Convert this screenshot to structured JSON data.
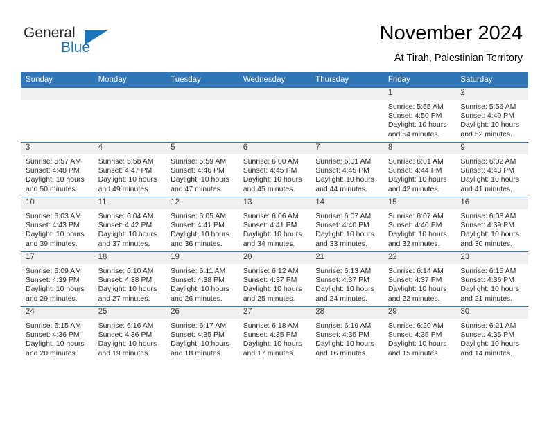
{
  "brand": {
    "name_part1": "General",
    "name_part2": "Blue",
    "triangle_color": "#1b75bb",
    "text_color": "#231f20"
  },
  "header": {
    "month_title": "November 2024",
    "location": "At Tirah, Palestinian Territory"
  },
  "theme": {
    "header_blue": "#3075b5",
    "date_band_gray": "#f0f0f0",
    "cell_white": "#ffffff"
  },
  "calendar": {
    "weekday_headers": [
      "Sunday",
      "Monday",
      "Tuesday",
      "Wednesday",
      "Thursday",
      "Friday",
      "Saturday"
    ],
    "weeks": [
      [
        {
          "day": "",
          "sunrise": "",
          "sunset": "",
          "daylight_line1": "",
          "daylight_line2": ""
        },
        {
          "day": "",
          "sunrise": "",
          "sunset": "",
          "daylight_line1": "",
          "daylight_line2": ""
        },
        {
          "day": "",
          "sunrise": "",
          "sunset": "",
          "daylight_line1": "",
          "daylight_line2": ""
        },
        {
          "day": "",
          "sunrise": "",
          "sunset": "",
          "daylight_line1": "",
          "daylight_line2": ""
        },
        {
          "day": "",
          "sunrise": "",
          "sunset": "",
          "daylight_line1": "",
          "daylight_line2": ""
        },
        {
          "day": "1",
          "sunrise": "Sunrise: 5:55 AM",
          "sunset": "Sunset: 4:50 PM",
          "daylight_line1": "Daylight: 10 hours",
          "daylight_line2": "and 54 minutes."
        },
        {
          "day": "2",
          "sunrise": "Sunrise: 5:56 AM",
          "sunset": "Sunset: 4:49 PM",
          "daylight_line1": "Daylight: 10 hours",
          "daylight_line2": "and 52 minutes."
        }
      ],
      [
        {
          "day": "3",
          "sunrise": "Sunrise: 5:57 AM",
          "sunset": "Sunset: 4:48 PM",
          "daylight_line1": "Daylight: 10 hours",
          "daylight_line2": "and 50 minutes."
        },
        {
          "day": "4",
          "sunrise": "Sunrise: 5:58 AM",
          "sunset": "Sunset: 4:47 PM",
          "daylight_line1": "Daylight: 10 hours",
          "daylight_line2": "and 49 minutes."
        },
        {
          "day": "5",
          "sunrise": "Sunrise: 5:59 AM",
          "sunset": "Sunset: 4:46 PM",
          "daylight_line1": "Daylight: 10 hours",
          "daylight_line2": "and 47 minutes."
        },
        {
          "day": "6",
          "sunrise": "Sunrise: 6:00 AM",
          "sunset": "Sunset: 4:45 PM",
          "daylight_line1": "Daylight: 10 hours",
          "daylight_line2": "and 45 minutes."
        },
        {
          "day": "7",
          "sunrise": "Sunrise: 6:01 AM",
          "sunset": "Sunset: 4:45 PM",
          "daylight_line1": "Daylight: 10 hours",
          "daylight_line2": "and 44 minutes."
        },
        {
          "day": "8",
          "sunrise": "Sunrise: 6:01 AM",
          "sunset": "Sunset: 4:44 PM",
          "daylight_line1": "Daylight: 10 hours",
          "daylight_line2": "and 42 minutes."
        },
        {
          "day": "9",
          "sunrise": "Sunrise: 6:02 AM",
          "sunset": "Sunset: 4:43 PM",
          "daylight_line1": "Daylight: 10 hours",
          "daylight_line2": "and 41 minutes."
        }
      ],
      [
        {
          "day": "10",
          "sunrise": "Sunrise: 6:03 AM",
          "sunset": "Sunset: 4:43 PM",
          "daylight_line1": "Daylight: 10 hours",
          "daylight_line2": "and 39 minutes."
        },
        {
          "day": "11",
          "sunrise": "Sunrise: 6:04 AM",
          "sunset": "Sunset: 4:42 PM",
          "daylight_line1": "Daylight: 10 hours",
          "daylight_line2": "and 37 minutes."
        },
        {
          "day": "12",
          "sunrise": "Sunrise: 6:05 AM",
          "sunset": "Sunset: 4:41 PM",
          "daylight_line1": "Daylight: 10 hours",
          "daylight_line2": "and 36 minutes."
        },
        {
          "day": "13",
          "sunrise": "Sunrise: 6:06 AM",
          "sunset": "Sunset: 4:41 PM",
          "daylight_line1": "Daylight: 10 hours",
          "daylight_line2": "and 34 minutes."
        },
        {
          "day": "14",
          "sunrise": "Sunrise: 6:07 AM",
          "sunset": "Sunset: 4:40 PM",
          "daylight_line1": "Daylight: 10 hours",
          "daylight_line2": "and 33 minutes."
        },
        {
          "day": "15",
          "sunrise": "Sunrise: 6:07 AM",
          "sunset": "Sunset: 4:40 PM",
          "daylight_line1": "Daylight: 10 hours",
          "daylight_line2": "and 32 minutes."
        },
        {
          "day": "16",
          "sunrise": "Sunrise: 6:08 AM",
          "sunset": "Sunset: 4:39 PM",
          "daylight_line1": "Daylight: 10 hours",
          "daylight_line2": "and 30 minutes."
        }
      ],
      [
        {
          "day": "17",
          "sunrise": "Sunrise: 6:09 AM",
          "sunset": "Sunset: 4:39 PM",
          "daylight_line1": "Daylight: 10 hours",
          "daylight_line2": "and 29 minutes."
        },
        {
          "day": "18",
          "sunrise": "Sunrise: 6:10 AM",
          "sunset": "Sunset: 4:38 PM",
          "daylight_line1": "Daylight: 10 hours",
          "daylight_line2": "and 27 minutes."
        },
        {
          "day": "19",
          "sunrise": "Sunrise: 6:11 AM",
          "sunset": "Sunset: 4:38 PM",
          "daylight_line1": "Daylight: 10 hours",
          "daylight_line2": "and 26 minutes."
        },
        {
          "day": "20",
          "sunrise": "Sunrise: 6:12 AM",
          "sunset": "Sunset: 4:37 PM",
          "daylight_line1": "Daylight: 10 hours",
          "daylight_line2": "and 25 minutes."
        },
        {
          "day": "21",
          "sunrise": "Sunrise: 6:13 AM",
          "sunset": "Sunset: 4:37 PM",
          "daylight_line1": "Daylight: 10 hours",
          "daylight_line2": "and 24 minutes."
        },
        {
          "day": "22",
          "sunrise": "Sunrise: 6:14 AM",
          "sunset": "Sunset: 4:37 PM",
          "daylight_line1": "Daylight: 10 hours",
          "daylight_line2": "and 22 minutes."
        },
        {
          "day": "23",
          "sunrise": "Sunrise: 6:15 AM",
          "sunset": "Sunset: 4:36 PM",
          "daylight_line1": "Daylight: 10 hours",
          "daylight_line2": "and 21 minutes."
        }
      ],
      [
        {
          "day": "24",
          "sunrise": "Sunrise: 6:15 AM",
          "sunset": "Sunset: 4:36 PM",
          "daylight_line1": "Daylight: 10 hours",
          "daylight_line2": "and 20 minutes."
        },
        {
          "day": "25",
          "sunrise": "Sunrise: 6:16 AM",
          "sunset": "Sunset: 4:36 PM",
          "daylight_line1": "Daylight: 10 hours",
          "daylight_line2": "and 19 minutes."
        },
        {
          "day": "26",
          "sunrise": "Sunrise: 6:17 AM",
          "sunset": "Sunset: 4:35 PM",
          "daylight_line1": "Daylight: 10 hours",
          "daylight_line2": "and 18 minutes."
        },
        {
          "day": "27",
          "sunrise": "Sunrise: 6:18 AM",
          "sunset": "Sunset: 4:35 PM",
          "daylight_line1": "Daylight: 10 hours",
          "daylight_line2": "and 17 minutes."
        },
        {
          "day": "28",
          "sunrise": "Sunrise: 6:19 AM",
          "sunset": "Sunset: 4:35 PM",
          "daylight_line1": "Daylight: 10 hours",
          "daylight_line2": "and 16 minutes."
        },
        {
          "day": "29",
          "sunrise": "Sunrise: 6:20 AM",
          "sunset": "Sunset: 4:35 PM",
          "daylight_line1": "Daylight: 10 hours",
          "daylight_line2": "and 15 minutes."
        },
        {
          "day": "30",
          "sunrise": "Sunrise: 6:21 AM",
          "sunset": "Sunset: 4:35 PM",
          "daylight_line1": "Daylight: 10 hours",
          "daylight_line2": "and 14 minutes."
        }
      ]
    ]
  }
}
